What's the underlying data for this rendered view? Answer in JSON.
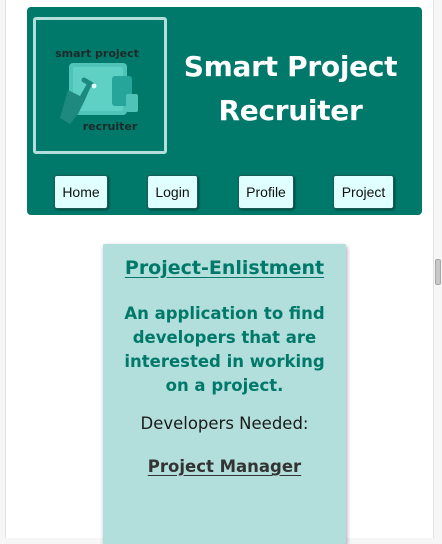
{
  "header": {
    "title_line1": "Smart Project",
    "title_line2": "Recruiter",
    "logo": {
      "text_top": "smart project",
      "text_bottom": "recruiter",
      "icon": "hand-tapping-devices-icon"
    },
    "nav": [
      {
        "label": "Home"
      },
      {
        "label": "Login"
      },
      {
        "label": "Profile"
      },
      {
        "label": "Project"
      }
    ]
  },
  "card": {
    "title": "Project-Enlistment",
    "description": "An application to find developers that are interested in working on a project.",
    "needed_label": "Developers Needed:",
    "role": "Project Manager"
  },
  "colors": {
    "brand": "#00796b",
    "card_bg": "#b2dfdb",
    "button_bg": "#e0ffff",
    "title_text": "#ffffff"
  }
}
